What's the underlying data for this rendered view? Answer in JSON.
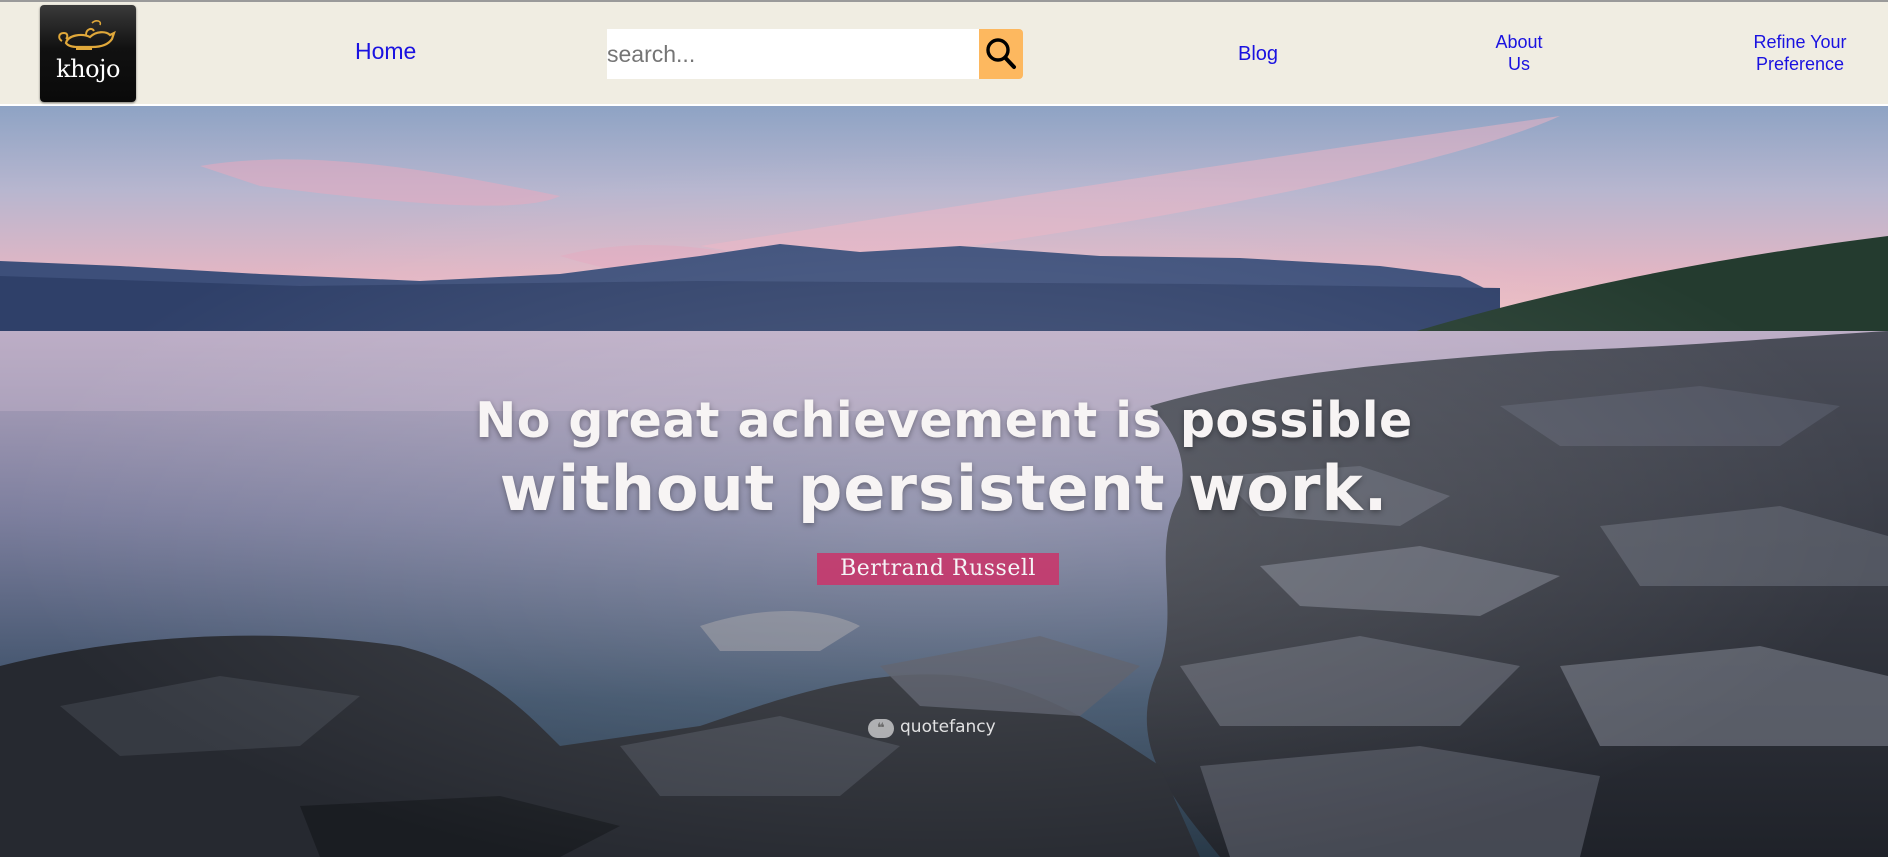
{
  "header": {
    "logo_text": "khojo",
    "nav": {
      "home": "Home",
      "blog": "Blog",
      "about": [
        "About",
        "Us"
      ],
      "refine": [
        "Refine Your",
        "Preference"
      ]
    },
    "search": {
      "placeholder": "search...",
      "value": ""
    }
  },
  "hero": {
    "quote_line_1": "No great achievement is possible",
    "quote_line_2": "without persistent work.",
    "author": "Bertrand Russell",
    "watermark": "quotefancy"
  },
  "colors": {
    "nav_background": "#f0ede2",
    "link": "#1a12e0",
    "search_button": "#fdb85f",
    "author_badge": "#c63a6e"
  }
}
